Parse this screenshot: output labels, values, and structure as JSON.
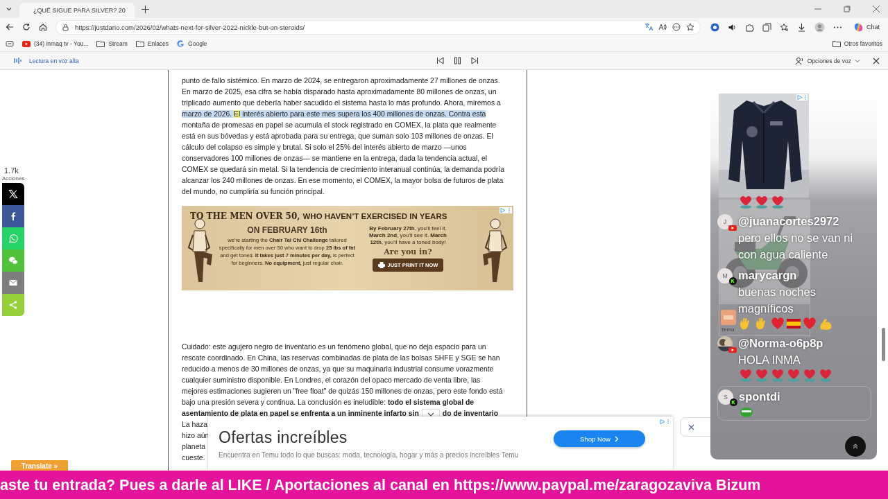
{
  "browser": {
    "tab_title": "¿QUÉ SIGUE PARA SILVER? 20",
    "url": "https://justdario.com/2026/02/whats-next-for-silver-2022-nickle-but-on-steroids/",
    "chat_button": "Chat",
    "bookmarks": [
      {
        "label": "(34) inmaq tv - You...",
        "kind": "youtube"
      },
      {
        "label": "Stream",
        "kind": "folder"
      },
      {
        "label": "Enlaces",
        "kind": "folder"
      },
      {
        "label": "Google",
        "kind": "google"
      }
    ],
    "other_favorites": "Otros favoritos"
  },
  "read_aloud": {
    "title": "Lectura en voz alta",
    "voice_options": "Opciones de voz"
  },
  "share": {
    "count": "1.7k",
    "label": "Acciones",
    "buttons": [
      {
        "kind": "x",
        "color": "#000000"
      },
      {
        "kind": "facebook",
        "color": "#3b5998"
      },
      {
        "kind": "whatsapp",
        "color": "#25d366"
      },
      {
        "kind": "wechat",
        "color": "#4fc13a"
      },
      {
        "kind": "email",
        "color": "#7d7d7d"
      },
      {
        "kind": "share",
        "color": "#95d03a"
      }
    ]
  },
  "article": {
    "paragraph_1": [
      "punto de fallo sistémico. En marzo de 2024, se entregaron aproximadamente 27 millones de onzas.",
      "En marzo de 2025, esa cifra se había disparado hasta aproximadamente 80 millones de onzas, un",
      "triplicado aumento que debería haber sacudido el sistema hasta lo más profundo. Ahora, miremos a",
      {
        "parts": [
          {
            "text": "marzo de 2026. ",
            "highlighted": true,
            "current": false
          },
          {
            "text": "El",
            "highlighted": true,
            "current": true
          },
          {
            "text": " interés abierto para este mes supera los 400 millones de onzas. Contra esta",
            "highlighted": true,
            "current": false
          }
        ]
      },
      "montaña de promesas en papel se acumula el stock registrado en COMEX, la plata que realmente",
      "está en sus bóvedas y está aprobada para su entrega, que suman solo 103 millones de onzas. El",
      "cálculo del colapso es simple y brutal. Si solo el 25% del interés abierto de marzo —unos",
      "conservadores 100 millones de onzas— se mantiene en la entrega, dada la tendencia actual, el",
      "COMEX se quedará sin metal. Si la tendencia de crecimiento interanual continúa, la demanda podría",
      "alcanzar los 240 millones de onzas. En ese momento, el COMEX, la mayor bolsa de futuros de plata",
      "del mundo, no cumpliría su función principal."
    ],
    "ad": {
      "headline_lead": "TO THE MEN OVER 50,",
      "headline_rest": "WHO HAVEN’T EXERCISED IN YEARS",
      "date": "ON FEBRUARY 16th",
      "body": "we're starting the **Chair Tai Chi Challenge** tailored specifically for men over 50 who want to drop **25 lbs of fat** and get toned. **It takes just 7 minutes per day,** is perfect for beginners. **No equipment,** just regular chair.",
      "timeline": "**By February 27th**, you'll feel it. **March 2nd**, you'll see it. **March 12th**, you'll have a toned body!",
      "question": "Are you in?",
      "button": "JUST PRINT IT NOW"
    },
    "paragraph_2": [
      "Cuidado: este agujero negro de inventario es un fenómeno global, que no deja espacio para un",
      "rescate coordinado. En China, las reservas combinadas de plata de las bolsas SHFE y SGE se han",
      "reducido a menos de 30 millones de onzas, ya que su maquinaria industrial consume vorazmente",
      "cualquier suministro disponible. En Londres, el corazón del opaco mercado de venta libre, las",
      "mejores estimaciones sugieren un \"free float\" de quizás 150 millones de onzas, pero este fondo está",
      "bajo una presión severa y continua. La conclusión es ineludible: **todo el sistema global de**",
      {
        "split": [
          "**asentamiento de plata en papel se enfrenta a un inminente infarto sin**",
          "**do de inventario**"
        ]
      },
      "La haza",
      "hizo aún",
      "planeta",
      "cueste."
    ]
  },
  "bottom_ad": {
    "title": "Ofertas increíbles",
    "text": "Encuentra en Temu todo lo que buscas: moda, tecnología, hogar y más a precios increíbles Temu",
    "button": "Shop Now"
  },
  "translate": "Translate »",
  "chat": {
    "ad_cards": [
      {
        "kind": "jacket"
      },
      {
        "kind": "bike",
        "brand": "Temu"
      }
    ],
    "messages": [
      {
        "emotes": [
          {
            "kind": "heart-face"
          },
          {
            "kind": "heart-face"
          },
          {
            "kind": "heart-face"
          }
        ],
        "highlighted": false
      },
      {
        "avatar": {
          "kind": "letter",
          "letter": "J"
        },
        "badge": {
          "kind": "youtube"
        },
        "name": "@juanacortes2972",
        "text": "pero ellos no se van ni con agua caliente",
        "highlighted": false
      },
      {
        "avatar": {
          "kind": "letter",
          "letter": "M"
        },
        "badge": {
          "kind": "kick"
        },
        "name": "marycargn",
        "text": "buenas noches magníficos",
        "emotes": [
          {
            "kind": "wave"
          },
          {
            "kind": "wave"
          },
          {
            "kind": "heart"
          },
          {
            "kind": "spain-flag"
          },
          {
            "kind": "heart"
          },
          {
            "kind": "muscle"
          }
        ],
        "highlighted": false
      },
      {
        "badge": {
          "kind": "youtube"
        },
        "name": "@Norma-o6p8p",
        "text": "HOLA INMA",
        "emotes": [
          {
            "kind": "heart-face"
          },
          {
            "kind": "heart-face"
          },
          {
            "kind": "heart-face"
          },
          {
            "kind": "heart-face"
          },
          {
            "kind": "heart-face"
          },
          {
            "kind": "heart-face"
          }
        ],
        "highlighted": false
      },
      {
        "avatar": {
          "kind": "letter",
          "letter": "S"
        },
        "badge": {
          "kind": "kick"
        },
        "name": "spontdi",
        "emotes": [
          {
            "kind": "frog"
          }
        ],
        "highlighted": true
      }
    ]
  },
  "ticker": "aste tu entrada? Pues a darle al LIKE / Aportaciones al canal en https://www.paypal.me/zaragozaviva Bizum"
}
